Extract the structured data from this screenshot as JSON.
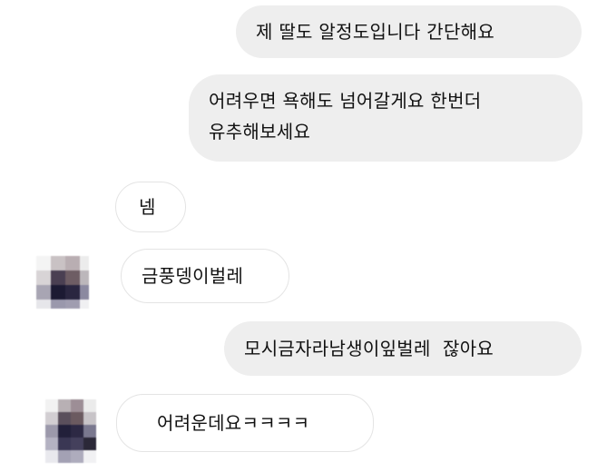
{
  "messages": [
    {
      "side": "sent",
      "text": "제 딸도 알정도입니다 간단해요"
    },
    {
      "side": "sent",
      "lines": [
        "어려우면 욕해도 넘어갈게요 한번더",
        "유추해보세요"
      ]
    },
    {
      "side": "received",
      "text": "넴"
    },
    {
      "side": "received",
      "text": "금풍뎅이벌레"
    },
    {
      "side": "sent",
      "text": "모시금자라남생이잎벌레  잖아요"
    },
    {
      "side": "received",
      "text": "어려운데요ㅋㅋㅋㅋ"
    }
  ],
  "colors": {
    "sent_bubble": "#eeeeee",
    "received_border": "#e4e4e4",
    "background": "#ffffff"
  }
}
